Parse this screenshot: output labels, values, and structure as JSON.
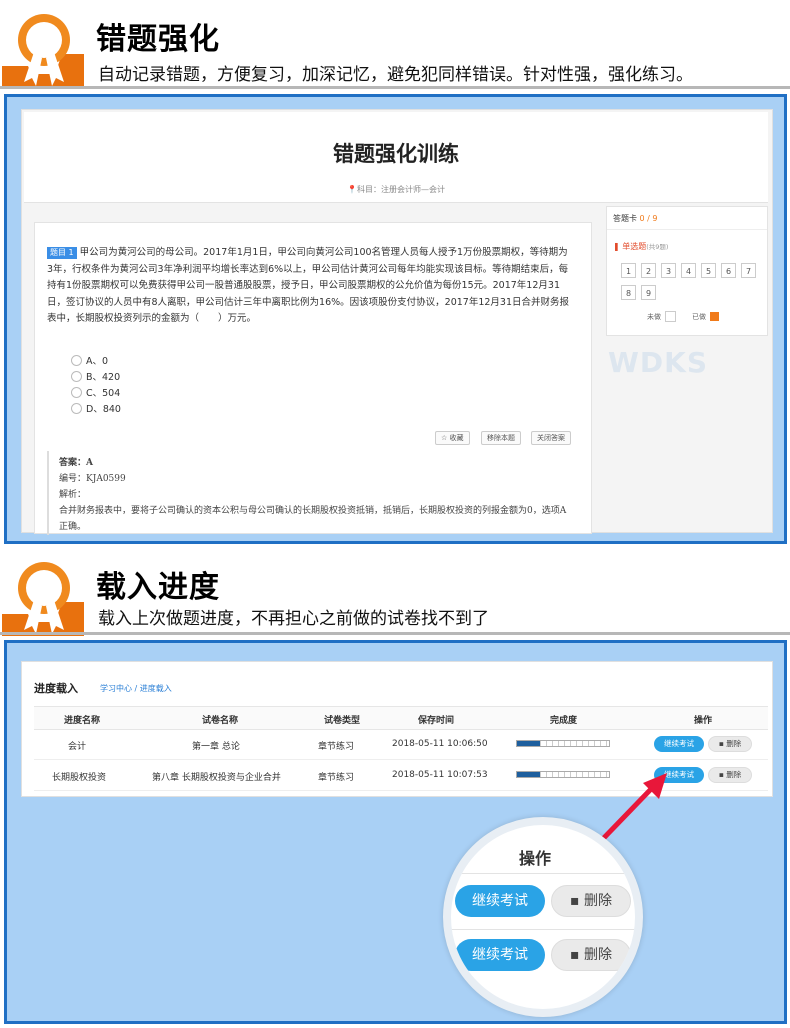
{
  "section1": {
    "title": "错题强化",
    "subtitle": "自动记录错题，方便复习，加深记忆，避免犯同样错误。针对性强，强化练习。"
  },
  "section2": {
    "title": "载入进度",
    "subtitle": "载入上次做题进度，不再担心之前做的试卷找不到了"
  },
  "quiz": {
    "page_title": "错题强化训练",
    "subject": "科目：注册会计师—会计",
    "question_tag": "题目 1",
    "question_text": "甲公司为黄河公司的母公司。2017年1月1日，甲公司向黄河公司100名管理人员每人授予1万份股票期权，等待期为3年，行权条件为黄河公司3年净利润平均增长率达到6%以上，甲公司估计黄河公司每年均能实现该目标。等待期结束后，每持有1份股票期权可以免费获得甲公司一股普通股股票，授予日，甲公司股票期权的公允价值为每份15元。2017年12月31日，签订协议的人员中有8人离职，甲公司估计三年中离职比例为16%。因该项股份支付协议，2017年12月31日合并财务报表中，长期股权投资列示的金额为（　　）万元。",
    "options": [
      "A、0",
      "B、420",
      "C、504",
      "D、840"
    ],
    "actions": [
      "☆ 收藏",
      "移除本题",
      "关闭答案"
    ],
    "answer_label": "答案：A",
    "code_label": "编号：KJA0599",
    "analysis_label": "解析：",
    "analysis_text": "合并财务报表中，要将子公司确认的资本公积与母公司确认的长期股权投资抵销，抵销后，长期股权投资的列报金额为0，选项A正确。"
  },
  "answer_card": {
    "title": "答题卡",
    "progress": "0 / 9",
    "section": "单选题",
    "section_count": "(共9题)",
    "numbers": [
      "1",
      "2",
      "3",
      "4",
      "5",
      "6",
      "7",
      "8",
      "9"
    ],
    "legend_undone": "未做",
    "legend_done": "已做",
    "done_color": "#f07a1a"
  },
  "watermark": "WDKS",
  "progress_page": {
    "title": "进度载入",
    "breadcrumb": "学习中心 / 进度载入",
    "headers": [
      "进度名称",
      "试卷名称",
      "试卷类型",
      "保存时间",
      "完成度",
      "操作"
    ],
    "rows": [
      {
        "name": "会计",
        "paper": "第一章 总论",
        "type": "章节练习",
        "time": "2018-05-11 10:06:50",
        "progress": 0.25
      },
      {
        "name": "长期股权投资",
        "paper": "第八章 长期股权投资与企业合并",
        "type": "章节练习",
        "time": "2018-05-11 10:07:53",
        "progress": 0.25
      }
    ],
    "continue_label": "继续考试",
    "delete_label": "删除",
    "zoom_header": "操作",
    "delete_icon_glyph": "🗑",
    "accent_blue": "#2aa3e6",
    "arrow_color": "#e8173a"
  }
}
